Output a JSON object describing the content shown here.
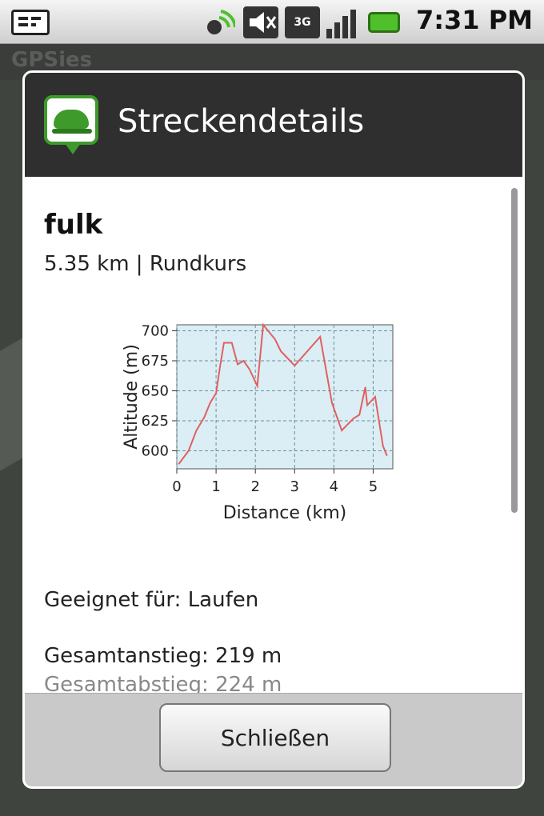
{
  "status_bar": {
    "time": "7:31 PM",
    "icons": [
      "notification-icon",
      "gps-icon",
      "mute-icon",
      "3g-icon",
      "signal-icon",
      "battery-icon"
    ],
    "network_label": "3G"
  },
  "app": {
    "title": "GPSies"
  },
  "dialog": {
    "title": "Streckendetails",
    "track_name": "fulk",
    "track_meta": "5.35 km | Rundkurs",
    "suitable_for": "Geeignet für: Laufen",
    "ascent": "Gesamtanstieg: 219 m",
    "descent": "Gesamtabstieg: 224 m",
    "close_label": "Schließen"
  },
  "chart_data": {
    "type": "line",
    "xlabel": "Distance (km)",
    "ylabel": "Altitude (m)",
    "xlim": [
      0,
      5.5
    ],
    "ylim": [
      585,
      705
    ],
    "xticks": [
      0,
      1,
      2,
      3,
      4,
      5
    ],
    "yticks": [
      600,
      625,
      650,
      675,
      700
    ],
    "grid": true,
    "background_color": "#dbeef5",
    "line_color": "#e06060",
    "x": [
      0.05,
      0.3,
      0.5,
      0.7,
      0.85,
      1.0,
      1.1,
      1.2,
      1.4,
      1.55,
      1.7,
      1.85,
      2.05,
      2.2,
      2.5,
      2.65,
      3.0,
      3.65,
      3.95,
      4.2,
      4.5,
      4.65,
      4.8,
      4.85,
      5.05,
      5.25,
      5.35
    ],
    "y": [
      589,
      600,
      617,
      628,
      640,
      648,
      670,
      690,
      690,
      672,
      675,
      668,
      654,
      705,
      693,
      683,
      671,
      695,
      640,
      617,
      627,
      630,
      653,
      638,
      645,
      604,
      596
    ]
  }
}
